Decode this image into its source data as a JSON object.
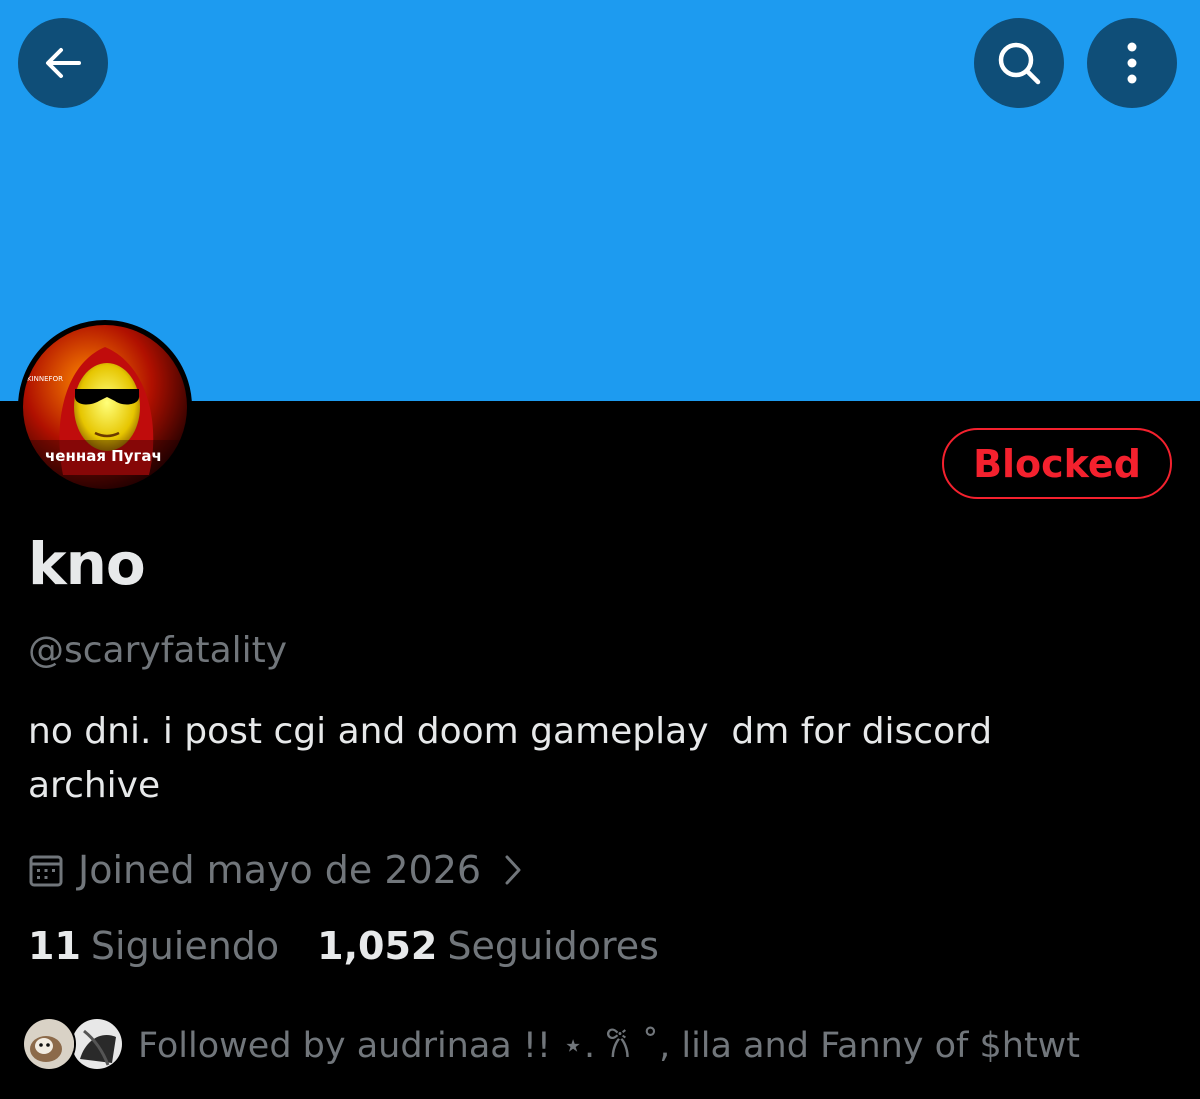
{
  "header": {
    "back_icon": "arrow-left-icon",
    "search_icon": "search-icon",
    "more_icon": "more-vertical-icon",
    "banner_color": "#1d9bf0"
  },
  "profile": {
    "avatar_text": "ченная Пугач",
    "avatar_small_text": "KINNEFOR",
    "display_name": "kno",
    "handle": "@scaryfatality",
    "bio": "no dni. i post cgi and doom gameplay  dm for discord\narchive",
    "joined": "Joined mayo de 2026",
    "blocked_label": "Blocked",
    "blocked_color": "#f4212e"
  },
  "stats": {
    "following_count": "11",
    "following_label": "Siguiendo",
    "followers_count": "1,052",
    "followers_label": "Seguidores"
  },
  "followed_by": {
    "text": "Followed by audrinaa !! ⋆. 𐙚 ˚, lila and Fanny of $htwt"
  },
  "colors": {
    "muted": "#71767b",
    "text": "#e7e9ea",
    "background": "#000000"
  }
}
